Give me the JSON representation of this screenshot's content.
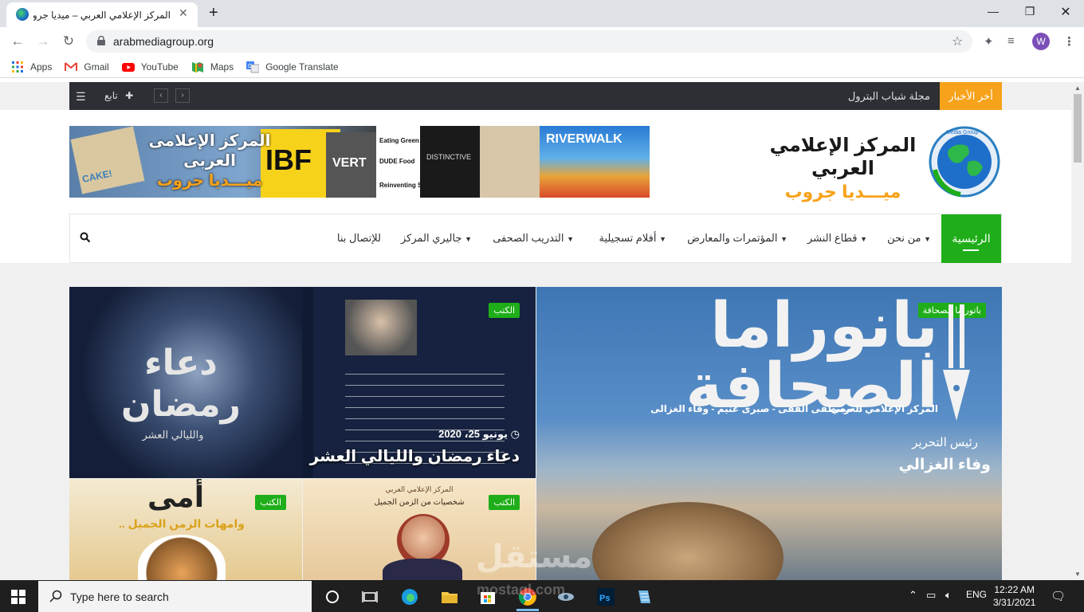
{
  "browser": {
    "tab_title": "المركز الإعلامي العربي – ميديا جروب",
    "url": "arabmediagroup.org",
    "profile_initial": "W",
    "bookmarks": [
      {
        "label": "Apps",
        "icon": "apps-grid-icon"
      },
      {
        "label": "Gmail",
        "icon": "gmail-icon"
      },
      {
        "label": "YouTube",
        "icon": "youtube-icon"
      },
      {
        "label": "Maps",
        "icon": "maps-icon"
      },
      {
        "label": "Google Translate",
        "icon": "translate-icon"
      }
    ]
  },
  "site": {
    "topbar": {
      "breaking_label": "أخر الأخبار",
      "ticker_text": "مجلة شباب البترول",
      "follow_label": "تابع"
    },
    "logo": {
      "title": "المركز الإعلامي العربي",
      "subtitle": "ميـــديا جروب",
      "badge_text": "Media Group"
    },
    "ad_banner": {
      "title": "المركز الإعلامى العربى",
      "subtitle": "ميـــديا جروب",
      "magazine_words": [
        "CAKE!",
        "IBF",
        "VERT",
        "Eating Green",
        "DUDE Food",
        "Reinventing Self",
        "DISTINCTIVE",
        "RIVERWALK"
      ]
    },
    "nav": {
      "home": "الرئيسية",
      "items": [
        "من نحن",
        "قطاع النشر",
        "المؤتمرات والمعارض",
        "أفلام تسجيلية",
        "التدريب الصحفى",
        "جاليري المركز",
        "للإتصال بنا"
      ]
    },
    "featured": {
      "big": {
        "badge": "باتوراما الصحافة",
        "cover_title": "بانوراما الصحافة",
        "cover_publisher": "المركز الإعلامي العربي",
        "cover_authors": "د. مصطفى الفقى - صبرى غنيم - وفاء الغزالى",
        "editor_label": "رئيس التحرير",
        "editor_name": "وفاء الغزالي"
      },
      "top": {
        "badge": "الكتب",
        "cover_title": "دعاء رمضان",
        "cover_subtitle": "والليالي العشر",
        "date": "يونيو 25، 2020",
        "headline": "دعاء رمضان والليالي العشر"
      },
      "bottom_left": {
        "badge": "الكتب",
        "cover_title": "أمى",
        "cover_subtitle": ".. وامهات الزمن الجميل"
      },
      "bottom_right": {
        "badge": "الكتب",
        "cover_publisher": "المركز الإعلامي العربي",
        "cover_title": "شخصيات من الزمن الجميل"
      }
    },
    "watermark": "مستقل",
    "watermark_latin": "mostaql.com"
  },
  "taskbar": {
    "search_placeholder": "Type here to search",
    "language": "ENG",
    "time": "12:22 AM",
    "date": "3/31/2021"
  },
  "colors": {
    "green": "#1fae19",
    "orange": "#f7a21b",
    "dark_bar": "#2c2f34"
  }
}
